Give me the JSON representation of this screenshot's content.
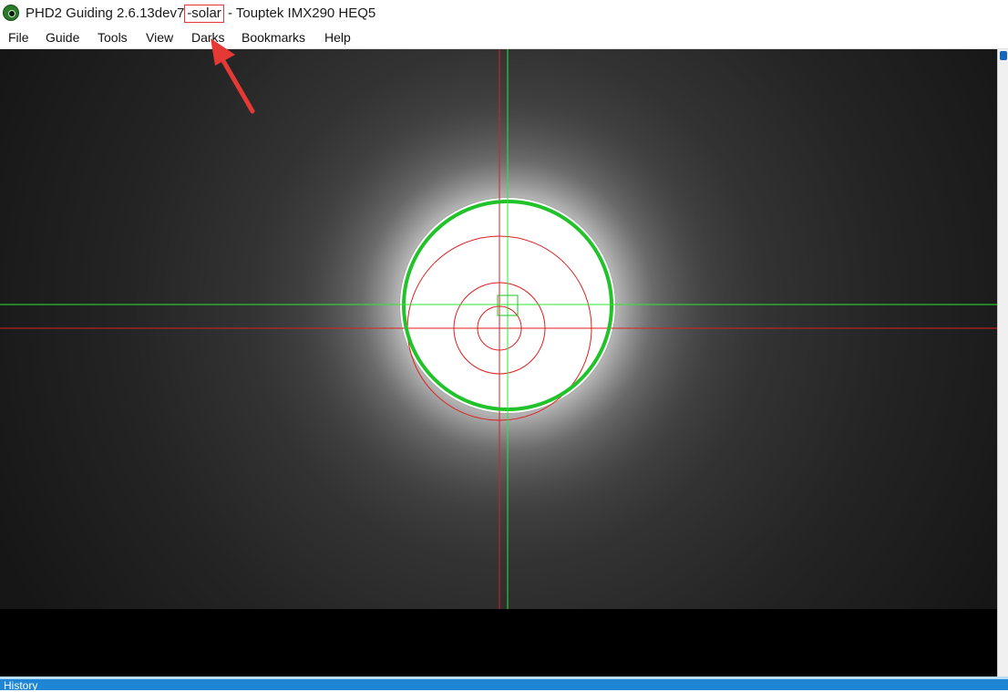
{
  "window": {
    "title_prefix": "PHD2 Guiding 2.6.13dev7",
    "title_highlight": "-solar",
    "title_suffix": " - Touptek IMX290 HEQ5",
    "icon": "phd2-eye-icon"
  },
  "menu": {
    "items": [
      {
        "label": "File"
      },
      {
        "label": "Guide"
      },
      {
        "label": "Tools"
      },
      {
        "label": "View"
      },
      {
        "label": "Darks"
      },
      {
        "label": "Bookmarks"
      },
      {
        "label": "Help"
      }
    ]
  },
  "bottom_panel": {
    "label": "History"
  },
  "colors": {
    "target_circle": "#22c22a",
    "guide_lines": "#2ee82e",
    "lock_lines": "#e01e1e",
    "annotation": "#e53935",
    "history_bar": "#1f86d6"
  }
}
